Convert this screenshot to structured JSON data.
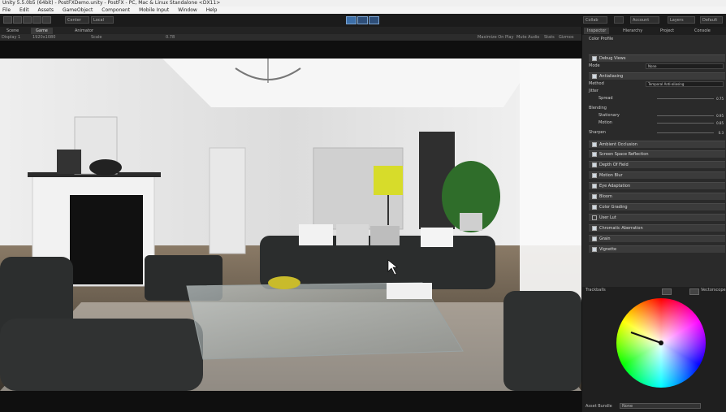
{
  "window": {
    "title": "Unity 5.5.0b5 (64bit) - PostFXDemo.unity - PostFX - PC, Mac & Linux Standalone <DX11>"
  },
  "menu": [
    "File",
    "Edit",
    "Assets",
    "GameObject",
    "Component",
    "Mobile Input",
    "Window",
    "Help"
  ],
  "toolbar": {
    "center_label": "Center",
    "local_label": "Local",
    "account_label": "Account",
    "layers_label": "Layers",
    "layout_label": "Default",
    "collab_label": "Collab"
  },
  "editor_tabs": {
    "scene": "Scene",
    "game": "Game",
    "animator": "Animator"
  },
  "game_view": {
    "display": "Display 1",
    "aspect": "1920x1080",
    "scale_label": "Scale",
    "scale_value": "0.78",
    "maximize": "Maximize On Play",
    "mute": "Mute Audio",
    "stats": "Stats",
    "gizmos": "Gizmos"
  },
  "inspector": {
    "tabs": [
      "Inspector",
      "Hierarchy",
      "Project",
      "Console"
    ],
    "component": "Color Profile",
    "sections": [
      {
        "label": "Debug Views",
        "enabled": false
      },
      {
        "label": "Antialiasing",
        "enabled": true
      },
      {
        "label": "Ambient Occlusion",
        "enabled": true
      },
      {
        "label": "Screen Space Reflection",
        "enabled": true
      },
      {
        "label": "Depth Of Field",
        "enabled": true
      },
      {
        "label": "Motion Blur",
        "enabled": true
      },
      {
        "label": "Eye Adaptation",
        "enabled": true
      },
      {
        "label": "Bloom",
        "enabled": true
      },
      {
        "label": "Color Grading",
        "enabled": true
      },
      {
        "label": "User Lut",
        "enabled": false
      },
      {
        "label": "Chromatic Aberration",
        "enabled": true
      },
      {
        "label": "Grain",
        "enabled": true
      },
      {
        "label": "Vignette",
        "enabled": true
      }
    ],
    "debug_mode_label": "Mode",
    "debug_mode_value": "None",
    "aa_method_label": "Method",
    "aa_method_value": "Temporal Anti-aliasing",
    "jitter_label": "Jitter",
    "spread_label": "Spread",
    "blending_label": "Blending",
    "stationary_label": "Stationary",
    "motion_label": "Motion",
    "sharpen_label": "Sharpen",
    "values": {
      "spread": "0.75",
      "stationary": "0.95",
      "motion": "0.85",
      "sharpen": "0.3"
    }
  },
  "preview": {
    "left_label": "Trackballs",
    "right_label": "Vectorscope",
    "footer_label": "Asset Bundle",
    "footer_value": "None"
  },
  "colors": {
    "accent": "#3d6fa8",
    "panel": "#2a2a2a",
    "section": "#3b3b3b"
  }
}
